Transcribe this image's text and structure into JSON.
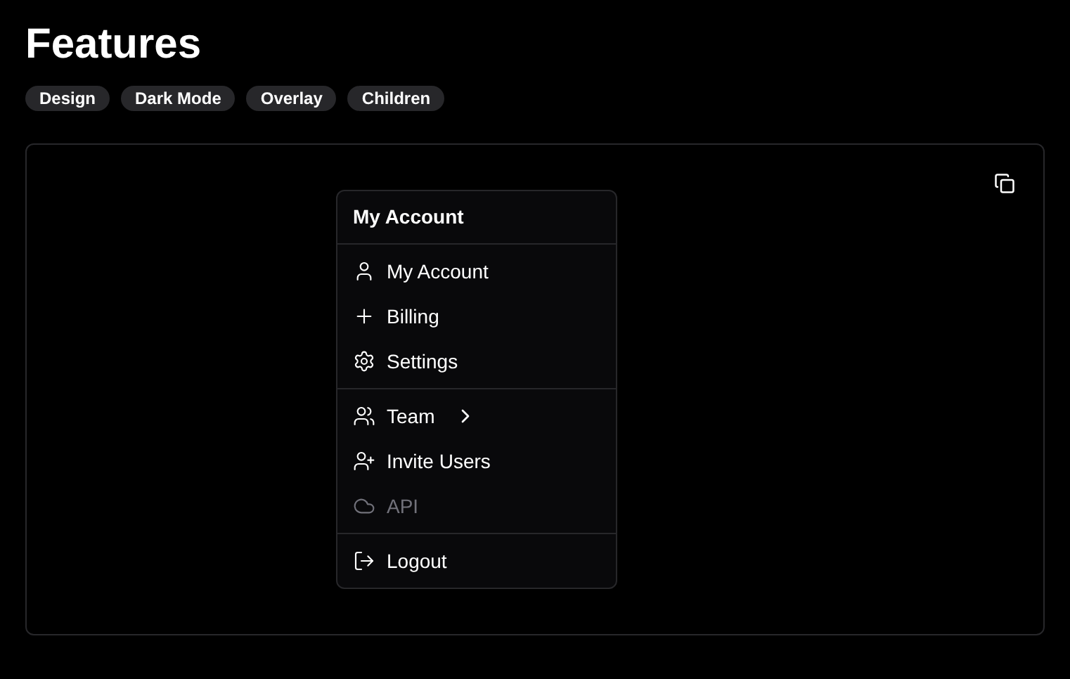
{
  "title": "Features",
  "tags": [
    "Design",
    "Dark Mode",
    "Overlay",
    "Children"
  ],
  "menu": {
    "label": "My Account",
    "groups": [
      {
        "items": [
          {
            "label": "My Account",
            "disabled": false,
            "submenu": false
          },
          {
            "label": "Billing",
            "disabled": false,
            "submenu": false
          },
          {
            "label": "Settings",
            "disabled": false,
            "submenu": false
          }
        ]
      },
      {
        "items": [
          {
            "label": "Team",
            "disabled": false,
            "submenu": true
          },
          {
            "label": "Invite Users",
            "disabled": false,
            "submenu": false
          },
          {
            "label": "API",
            "disabled": true,
            "submenu": false
          }
        ]
      },
      {
        "items": [
          {
            "label": "Logout",
            "disabled": false,
            "submenu": false
          }
        ]
      }
    ]
  }
}
